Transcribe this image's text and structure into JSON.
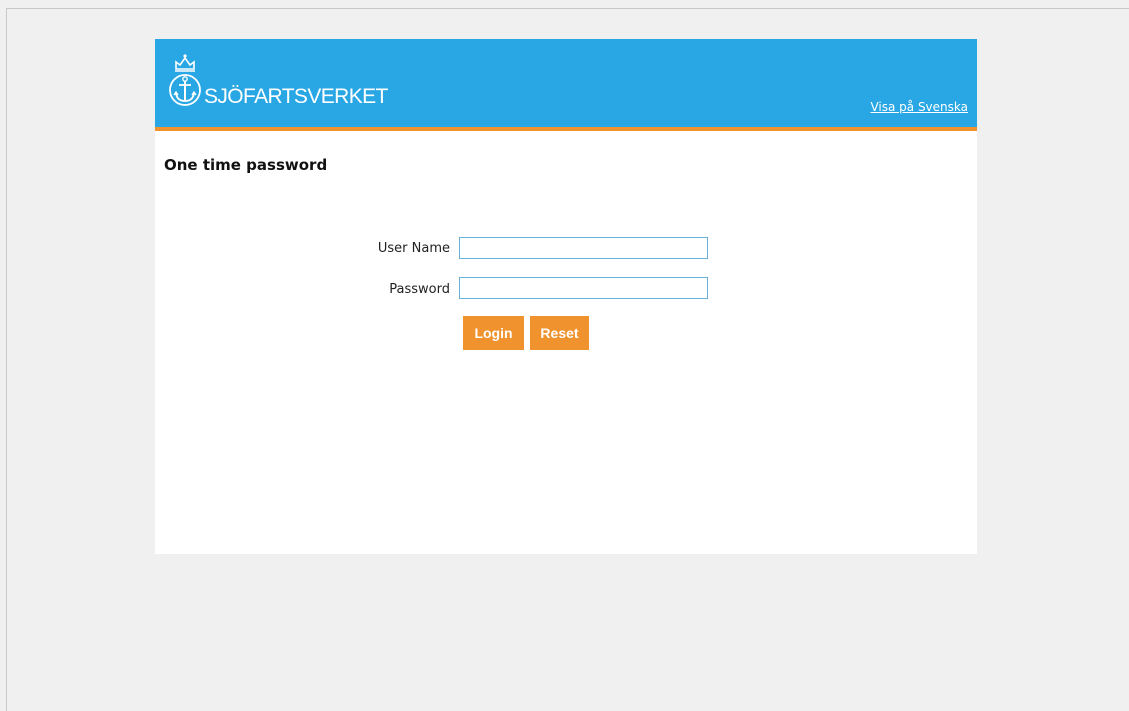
{
  "header": {
    "logo_text": "SJÖFARTSVERKET",
    "language_link": "Visa på Svenska"
  },
  "page": {
    "title": "One time password"
  },
  "form": {
    "username_label": "User Name",
    "username_value": "",
    "password_label": "Password",
    "password_value": "",
    "login_label": "Login",
    "reset_label": "Reset"
  },
  "colors": {
    "header_bg": "#29a7e4",
    "accent": "#f0932e",
    "input_border": "#6ab0dc",
    "page_bg": "#f0f0f0"
  },
  "icons": {
    "logo": "crowned-anchor-icon"
  }
}
